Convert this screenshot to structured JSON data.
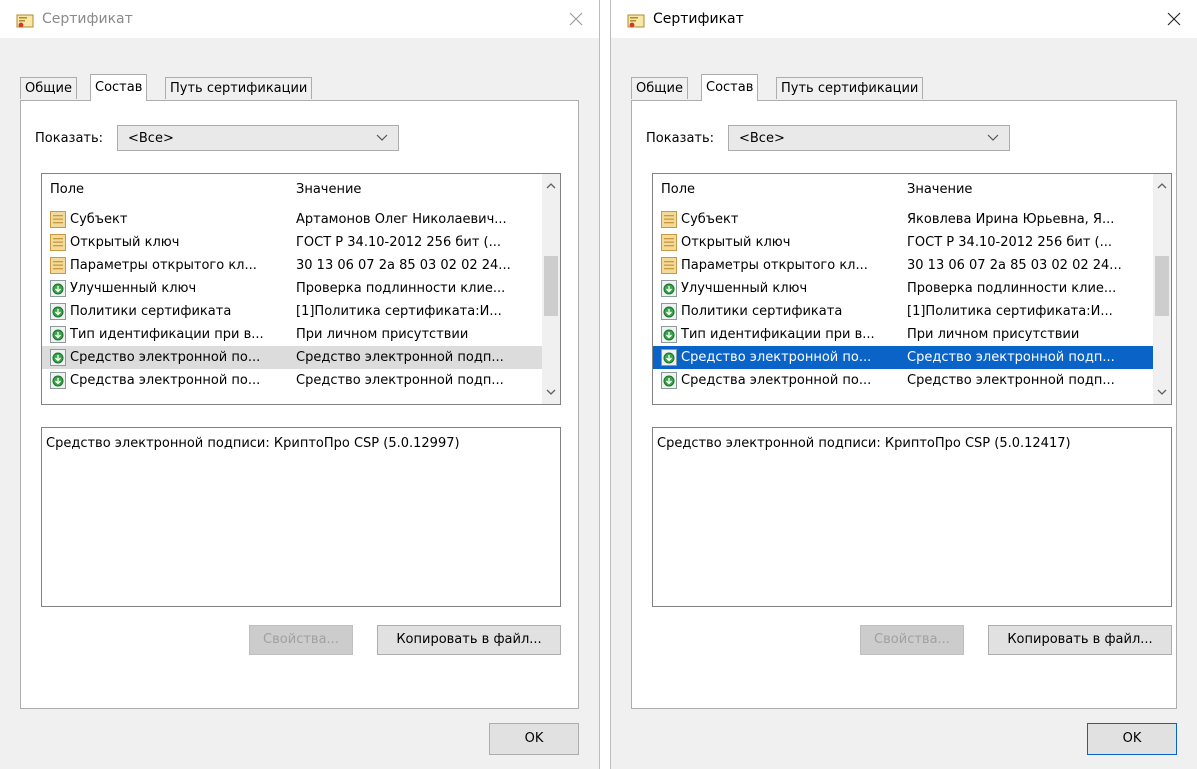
{
  "colors": {
    "dialog_bg": "#f0f0f0",
    "selection_blue": "#0a64c8",
    "selection_grey": "#dcdcdc"
  },
  "dialogs": [
    {
      "title": "Сертификат",
      "tabs": [
        {
          "label": "Общие"
        },
        {
          "label": "Состав"
        },
        {
          "label": "Путь сертификации"
        }
      ],
      "show_label": "Показать:",
      "show_value": "<Все>",
      "columns": {
        "field": "Поле",
        "value": "Значение"
      },
      "rows": [
        {
          "icon": "certificate-field-icon",
          "field": "Субъект",
          "value": "Артамонов Олег Николаевич..."
        },
        {
          "icon": "certificate-field-icon",
          "field": "Открытый ключ",
          "value": "ГОСТ Р 34.10-2012 256 бит (..."
        },
        {
          "icon": "certificate-field-icon",
          "field": "Параметры открытого кл...",
          "value": "30 13 06 07 2a 85 03 02 02 24..."
        },
        {
          "icon": "extension-icon",
          "field": "Улучшенный ключ",
          "value": "Проверка подлинности клие..."
        },
        {
          "icon": "extension-icon",
          "field": "Политики сертификата",
          "value": "[1]Политика сертификата:И..."
        },
        {
          "icon": "extension-icon",
          "field": "Тип идентификации при в...",
          "value": "При личном присутствии"
        },
        {
          "icon": "extension-icon",
          "field": "Средство электронной по...",
          "value": "Средство электронной подп..."
        },
        {
          "icon": "extension-icon",
          "field": "Средства электронной по...",
          "value": "Средство электронной подп..."
        }
      ],
      "detail_text": "Средство электронной подписи: КриптоПро CSP (5.0.12997)",
      "btn_properties": "Свойства...",
      "btn_copy": "Копировать в файл...",
      "btn_ok": "OK"
    },
    {
      "title": "Сертификат",
      "tabs": [
        {
          "label": "Общие"
        },
        {
          "label": "Состав"
        },
        {
          "label": "Путь сертификации"
        }
      ],
      "show_label": "Показать:",
      "show_value": "<Все>",
      "columns": {
        "field": "Поле",
        "value": "Значение"
      },
      "rows": [
        {
          "icon": "certificate-field-icon",
          "field": "Субъект",
          "value": "Яковлева Ирина Юрьевна, Я..."
        },
        {
          "icon": "certificate-field-icon",
          "field": "Открытый ключ",
          "value": "ГОСТ Р 34.10-2012 256 бит (..."
        },
        {
          "icon": "certificate-field-icon",
          "field": "Параметры открытого кл...",
          "value": "30 13 06 07 2a 85 03 02 02 24..."
        },
        {
          "icon": "extension-icon",
          "field": "Улучшенный ключ",
          "value": "Проверка подлинности клие..."
        },
        {
          "icon": "extension-icon",
          "field": "Политики сертификата",
          "value": "[1]Политика сертификата:И..."
        },
        {
          "icon": "extension-icon",
          "field": "Тип идентификации при в...",
          "value": "При личном присутствии"
        },
        {
          "icon": "extension-icon",
          "field": "Средство электронной по...",
          "value": "Средство электронной подп..."
        },
        {
          "icon": "extension-icon",
          "field": "Средства электронной по...",
          "value": "Средство электронной подп..."
        }
      ],
      "detail_text": "Средство электронной подписи: КриптоПро CSP (5.0.12417)",
      "btn_properties": "Свойства...",
      "btn_copy": "Копировать в файл...",
      "btn_ok": "OK"
    }
  ]
}
